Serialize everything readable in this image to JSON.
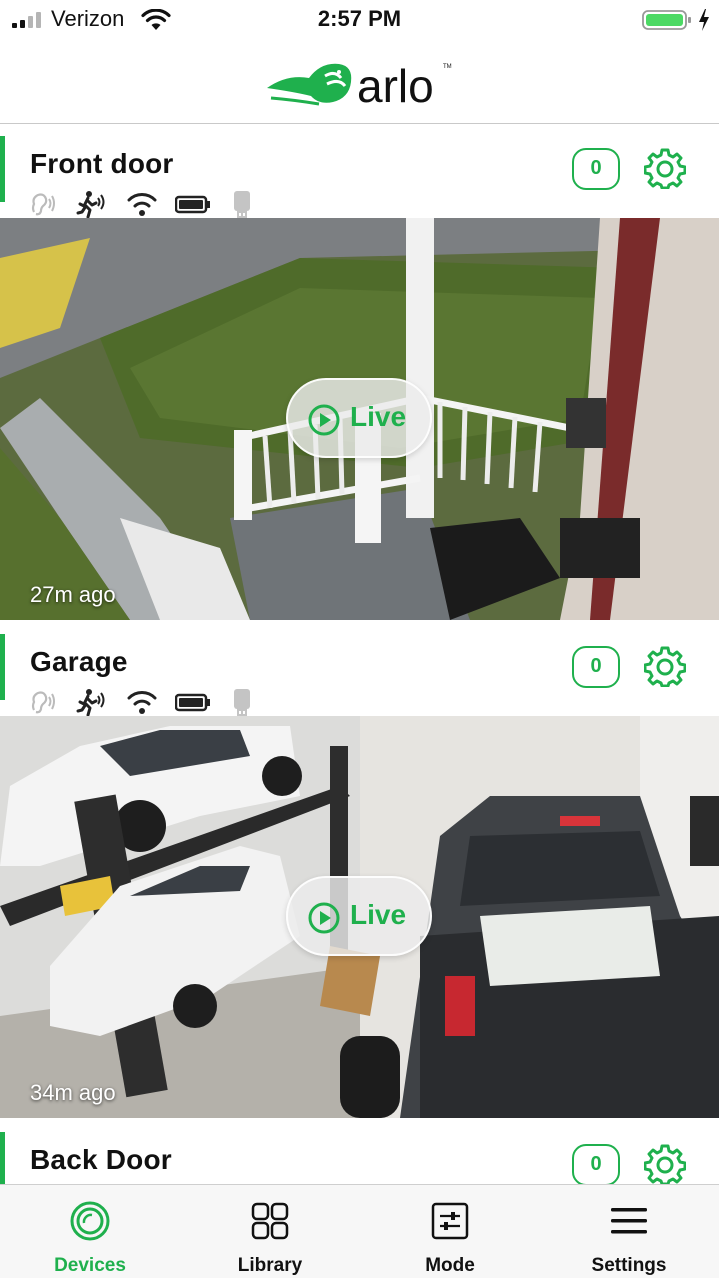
{
  "status_bar": {
    "carrier": "Verizon",
    "time": "2:57 PM"
  },
  "header": {
    "logo_text": "arlo",
    "logo_tm": "TM"
  },
  "devices": [
    {
      "name": "Front door",
      "notification_count": "0",
      "live_label": "Live",
      "last_seen": "27m ago"
    },
    {
      "name": "Garage",
      "notification_count": "0",
      "live_label": "Live",
      "last_seen": "34m ago"
    },
    {
      "name": "Back Door",
      "notification_count": "0"
    }
  ],
  "nav": [
    {
      "label": "Devices",
      "icon": "devices-icon",
      "active": true
    },
    {
      "label": "Library",
      "icon": "library-icon"
    },
    {
      "label": "Mode",
      "icon": "mode-icon"
    },
    {
      "label": "Settings",
      "icon": "menu-icon"
    }
  ],
  "colors": {
    "accent": "#1fb04d",
    "battery": "#4cd964"
  },
  "status_icons": [
    "audio-icon",
    "motion-icon",
    "wifi-icon",
    "battery-icon",
    "storage-icon"
  ]
}
